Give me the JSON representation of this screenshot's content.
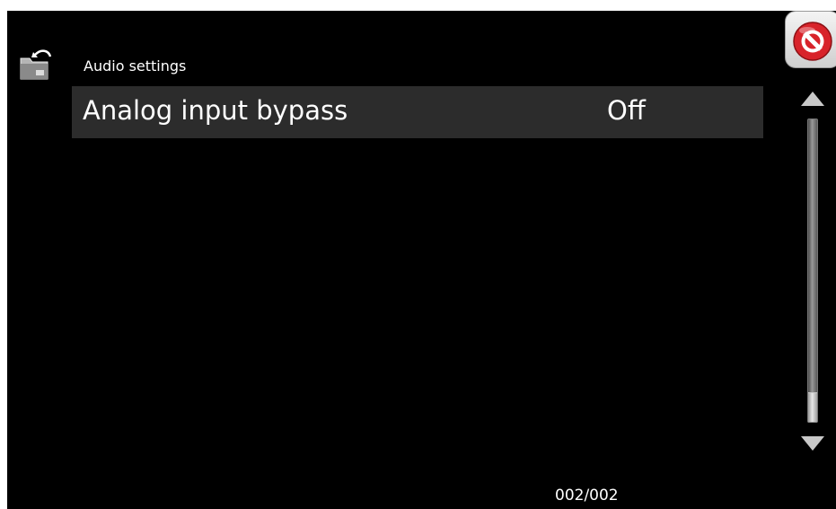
{
  "header": {
    "title": "Audio settings",
    "back_icon": "folder-back-icon",
    "close_icon": "prohibited-icon"
  },
  "menu": {
    "items": [
      {
        "label": "Analog input bypass",
        "value": "Off"
      }
    ]
  },
  "scrollbar": {
    "up_icon": "triangle-up-icon",
    "down_icon": "triangle-down-icon",
    "position_fraction": 1.0
  },
  "footer": {
    "page_counter": "002/002"
  },
  "colors": {
    "background": "#000000",
    "row_background": "#2c2c2c",
    "text": "#ffffff",
    "close_red": "#d8232a"
  }
}
